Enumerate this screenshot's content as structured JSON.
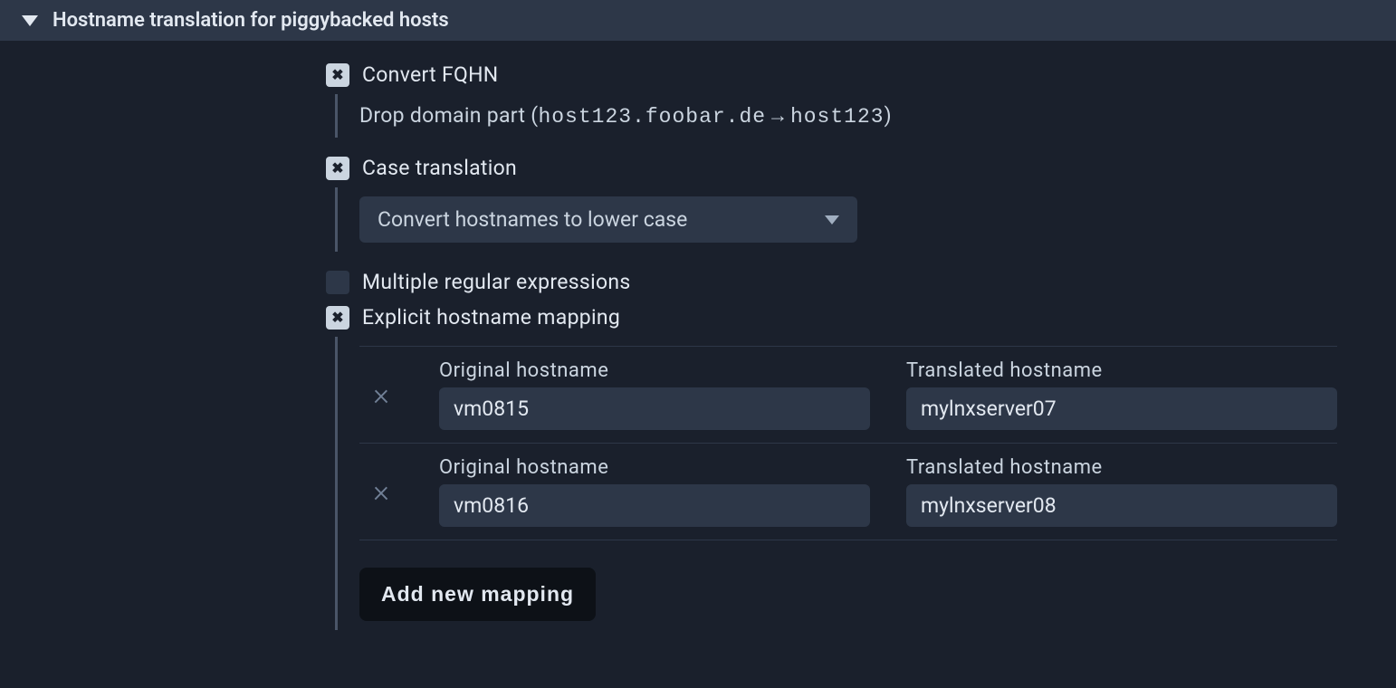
{
  "section": {
    "title": "Hostname translation for piggybacked hosts"
  },
  "options": {
    "convert_fqhn": {
      "label": "Convert FQHN",
      "desc_prefix": "Drop domain part (",
      "example_from": "host123.foobar.de",
      "arrow": "→",
      "example_to": "host123",
      "desc_suffix": ")"
    },
    "case_translation": {
      "label": "Case translation",
      "selected": "Convert hostnames to lower case"
    },
    "multi_regex": {
      "label": "Multiple regular expressions"
    },
    "explicit_mapping": {
      "label": "Explicit hostname mapping",
      "original_col": "Original hostname",
      "translated_col": "Translated hostname",
      "rows": [
        {
          "original": "vm0815",
          "translated": "mylnxserver07"
        },
        {
          "original": "vm0816",
          "translated": "mylnxserver08"
        }
      ],
      "add_button": "Add new mapping"
    }
  }
}
